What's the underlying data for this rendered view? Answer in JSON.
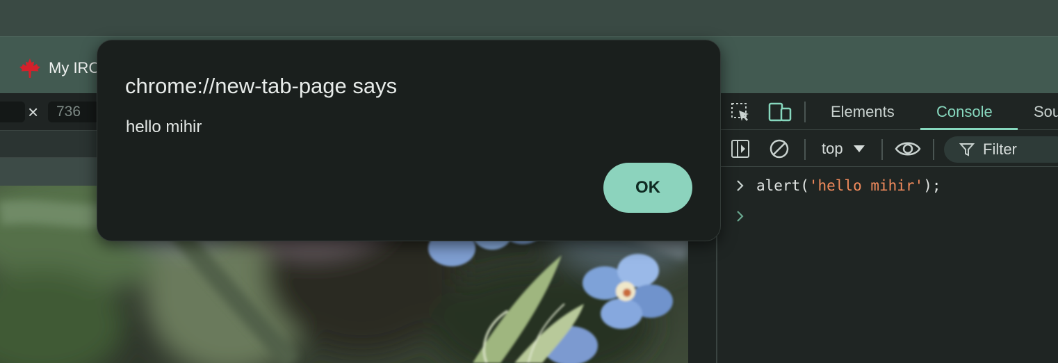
{
  "browser": {
    "bookmark": {
      "label": "My IRCC",
      "icon": "maple-leaf-icon"
    }
  },
  "device_toolbar": {
    "width_value": "",
    "height_value": "736",
    "separator": "×"
  },
  "devtools": {
    "tabs": [
      {
        "label": "Elements",
        "active": false
      },
      {
        "label": "Console",
        "active": true
      },
      {
        "label": "Sources",
        "active": false
      }
    ],
    "toolbar": {
      "context": "top",
      "filter_label": "Filter"
    },
    "console": {
      "prompt_symbol": ">",
      "command_fn": "alert(",
      "command_arg": "'hello mihir'",
      "command_end": ");"
    },
    "accent_color": "#87d8be",
    "string_color": "#f28b5c"
  },
  "dialog": {
    "title": "chrome://new-tab-page says",
    "message": "hello mihir",
    "ok_label": "OK",
    "button_color": "#8cd3bd"
  }
}
